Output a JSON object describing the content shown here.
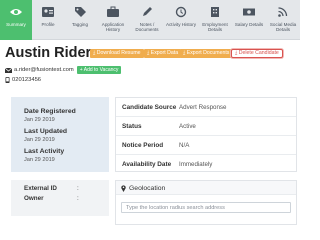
{
  "tabs": [
    {
      "label": "Summary",
      "icon": "eye-icon",
      "active": true
    },
    {
      "label": "Profile",
      "icon": "id-card-icon",
      "active": false
    },
    {
      "label": "Tagging",
      "icon": "tag-icon",
      "active": false
    },
    {
      "label": "Application History",
      "icon": "briefcase-icon",
      "active": false
    },
    {
      "label": "Notes / Documents",
      "icon": "pencil-icon",
      "active": false
    },
    {
      "label": "Activity History",
      "icon": "history-icon",
      "active": false
    },
    {
      "label": "Employment Details",
      "icon": "building-icon",
      "active": false
    },
    {
      "label": "Salary Details",
      "icon": "money-icon",
      "active": false
    },
    {
      "label": "Social Media Details",
      "icon": "rss-icon",
      "active": false
    }
  ],
  "candidate": {
    "name": "Austin Rider",
    "email": "a.rider@fusiontest.com",
    "phone": "020123456"
  },
  "actions": {
    "download_resume": "Download Resume",
    "export_data": "Export Data",
    "export_documents": "Export Documents",
    "delete_candidate": "Delete Candidate",
    "add_to_vacancy": "+ Add to Vacancy"
  },
  "dates": [
    {
      "label": "Date Registered",
      "value": "Jan 29 2019"
    },
    {
      "label": "Last Updated",
      "value": "Jan 29 2019"
    },
    {
      "label": "Last Activity",
      "value": "Jan 29 2019"
    }
  ],
  "external": {
    "external_id_label": "External ID",
    "owner_label": "Owner",
    "colon": ":"
  },
  "details": [
    {
      "key": "Candidate Source",
      "value": "Advert Response"
    },
    {
      "key": "Status",
      "value": "Active"
    },
    {
      "key": "Notice Period",
      "value": "N/A"
    },
    {
      "key": "Availability Date",
      "value": "Immediately"
    }
  ],
  "geolocation": {
    "title": "Geolocation",
    "placeholder": "Type the location radius search address"
  },
  "colors": {
    "active_tab": "#4dbf6f",
    "orange_button": "#f0ad4e",
    "delete_red": "#d9534f",
    "info_box_bg": "#e3ebf3"
  }
}
